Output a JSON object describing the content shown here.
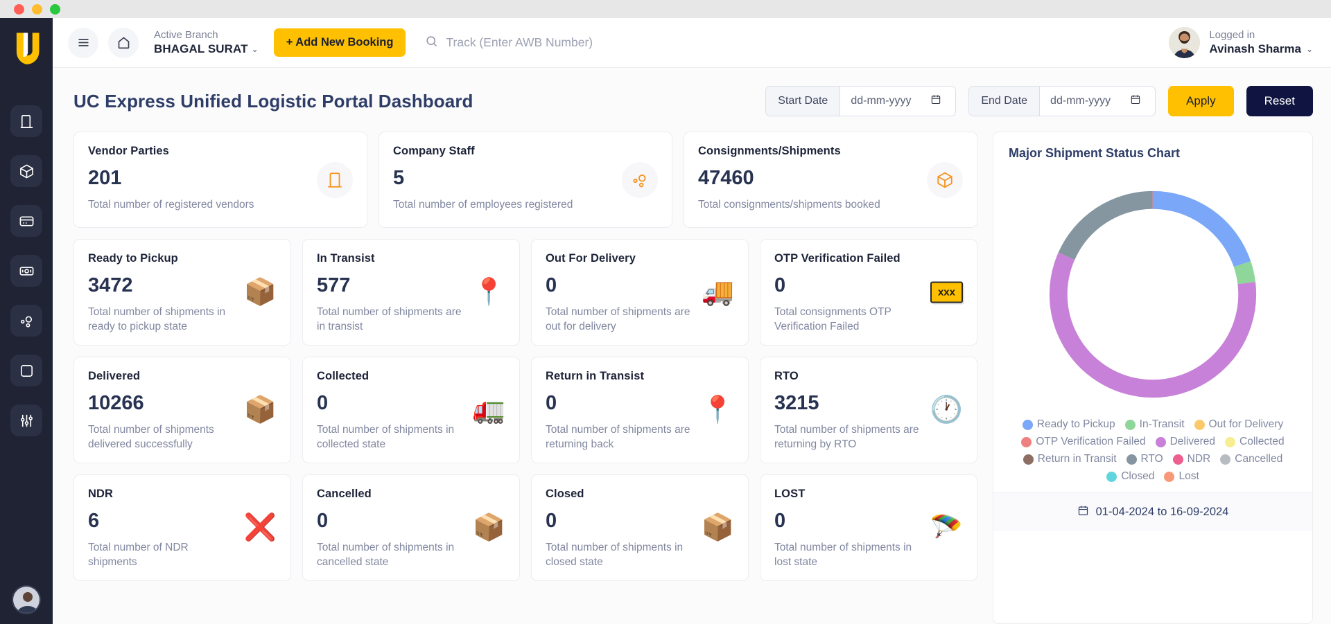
{
  "window": {
    "controls": [
      "close",
      "minimize",
      "maximize"
    ]
  },
  "sidebar": {
    "brand": "UC",
    "items": [
      {
        "name": "building",
        "label": "Vendor Parties"
      },
      {
        "name": "box",
        "label": "Shipments"
      },
      {
        "name": "card",
        "label": "Payments"
      },
      {
        "name": "cash",
        "label": "Billing"
      },
      {
        "name": "network",
        "label": "Network"
      },
      {
        "name": "grid",
        "label": "Modules"
      },
      {
        "name": "sliders",
        "label": "Settings"
      }
    ]
  },
  "topbar": {
    "branch_label": "Active Branch",
    "branch_value": "BHAGAL SURAT",
    "branch_caret": "⌄",
    "add_booking_label": "+ Add New Booking",
    "track_placeholder": "Track (Enter AWB Number)",
    "track_value": "",
    "user_status": "Logged in",
    "user_name": "Avinash Sharma",
    "user_caret": "⌄"
  },
  "page": {
    "title": "UC Express Unified Logistic Portal Dashboard",
    "filters": {
      "start_label": "Start Date",
      "start_value": "dd-mm-yyyy",
      "end_label": "End Date",
      "end_value": "dd-mm-yyyy",
      "apply_label": "Apply",
      "reset_label": "Reset"
    }
  },
  "summary_cards": [
    {
      "title": "Vendor Parties",
      "value": "201",
      "desc": "Total number of registered vendors",
      "icon": "building-icon"
    },
    {
      "title": "Company Staff",
      "value": "5",
      "desc": "Total number of employees registered",
      "icon": "network-icon"
    },
    {
      "title": "Consignments/Shipments",
      "value": "47460",
      "desc": "Total consignments/shipments booked",
      "icon": "box-icon"
    }
  ],
  "status_cards": [
    {
      "title": "Ready to Pickup",
      "value": "3472",
      "desc": "Total number of shipments in ready to pickup state",
      "icon": "package-emoji",
      "glyph": "📦"
    },
    {
      "title": "In Transist",
      "value": "577",
      "desc": "Total number of shipments are in transist",
      "icon": "map-pin-emoji",
      "glyph": "📍"
    },
    {
      "title": "Out For Delivery",
      "value": "0",
      "desc": "Total number of shipments are out for delivery",
      "icon": "delivery-truck-emoji",
      "glyph": "🚚"
    },
    {
      "title": "OTP Verification Failed",
      "value": "0",
      "desc": "Total consignments OTP Verification Failed",
      "icon": "xxx-badge-icon",
      "glyph": "xxx"
    },
    {
      "title": "Delivered",
      "value": "10266",
      "desc": "Total number of shipments delivered successfully",
      "icon": "delivered-box-emoji",
      "glyph": "📦"
    },
    {
      "title": "Collected",
      "value": "0",
      "desc": "Total number of shipments in collected state",
      "icon": "collected-truck-emoji",
      "glyph": "🚛"
    },
    {
      "title": "Return in Transist",
      "value": "0",
      "desc": "Total number of shipments are returning back",
      "icon": "return-pin-emoji",
      "glyph": "📍"
    },
    {
      "title": "RTO",
      "value": "3215",
      "desc": "Total number of shipments are returning by RTO",
      "icon": "clock-arrow-emoji",
      "glyph": "🕐"
    },
    {
      "title": "NDR",
      "value": "6",
      "desc": "Total number of NDR shipments",
      "icon": "failed-route-emoji",
      "glyph": "❌"
    },
    {
      "title": "Cancelled",
      "value": "0",
      "desc": "Total number of shipments in cancelled state",
      "icon": "cancelled-box-emoji",
      "glyph": "📦"
    },
    {
      "title": "Closed",
      "value": "0",
      "desc": "Total number of shipments in closed state",
      "icon": "closed-box-emoji",
      "glyph": "📦"
    },
    {
      "title": "LOST",
      "value": "0",
      "desc": "Total number of shipments in lost state",
      "icon": "parachute-emoji",
      "glyph": "🪂"
    }
  ],
  "chart_panel": {
    "title": "Major Shipment Status Chart",
    "range_text": "01-04-2024 to 16-09-2024",
    "calendar_icon": "calendar-icon"
  },
  "chart_data": {
    "type": "pie",
    "variant": "donut",
    "title": "Major Shipment Status Chart",
    "legend_position": "bottom",
    "categories": [
      "Ready to Pickup",
      "In-Transit",
      "Out for Delivery",
      "OTP Verification Failed",
      "Delivered",
      "Collected",
      "Return in Transit",
      "RTO",
      "NDR",
      "Cancelled",
      "Closed",
      "Lost"
    ],
    "values": [
      3472,
      577,
      0,
      0,
      10266,
      0,
      0,
      3215,
      6,
      0,
      0,
      0
    ],
    "colors": [
      "#7aa7f7",
      "#8fd69a",
      "#fbc96a",
      "#ef8080",
      "#c881d8",
      "#f6ee90",
      "#8d6e63",
      "#8596a0",
      "#ec5f8e",
      "#b8bcc2",
      "#5fd6dd",
      "#f79878"
    ],
    "total": 17536,
    "start_angle": 0
  }
}
